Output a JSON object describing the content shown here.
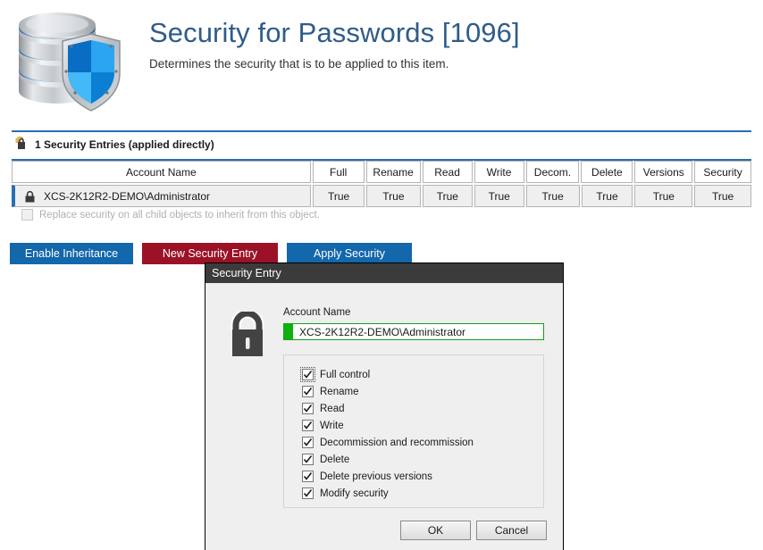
{
  "header": {
    "title": "Security for Passwords [1096]",
    "subtitle": "Determines the security that is to be applied to this item.",
    "icon": "database-shield-icon"
  },
  "section": {
    "icon": "open-lock-icon",
    "label": "1 Security Entries (applied directly)"
  },
  "grid": {
    "columns": [
      "Account Name",
      "Full",
      "Rename",
      "Read",
      "Write",
      "Decom.",
      "Delete",
      "Versions",
      "Security"
    ],
    "rows": [
      {
        "icon": "lock-icon",
        "account": "XCS-2K12R2-DEMO\\Administrator",
        "full": "True",
        "rename": "True",
        "read": "True",
        "write": "True",
        "decom": "True",
        "delete": "True",
        "versions": "True",
        "security": "True"
      }
    ]
  },
  "replace_option": {
    "label": "Replace security on all child objects to inherit from this object.",
    "checked": false,
    "enabled": false
  },
  "actions": {
    "enable_inheritance": "Enable Inheritance",
    "new_security_entry": "New Security Entry",
    "apply_security": "Apply Security"
  },
  "dialog": {
    "title": "Security Entry",
    "icon": "padlock-icon",
    "account_name_label": "Account Name",
    "account_name_value": "XCS-2K12R2-DEMO\\Administrator",
    "permissions": [
      {
        "label": "Full control",
        "checked": true,
        "focused": true
      },
      {
        "label": "Rename",
        "checked": true,
        "focused": false
      },
      {
        "label": "Read",
        "checked": true,
        "focused": false
      },
      {
        "label": "Write",
        "checked": true,
        "focused": false
      },
      {
        "label": "Decommission and recommission",
        "checked": true,
        "focused": false
      },
      {
        "label": "Delete",
        "checked": true,
        "focused": false
      },
      {
        "label": "Delete previous versions",
        "checked": true,
        "focused": false
      },
      {
        "label": "Modify security",
        "checked": true,
        "focused": false
      }
    ],
    "ok_label": "OK",
    "cancel_label": "Cancel"
  },
  "colors": {
    "accent_blue": "#2a6fb4",
    "button_blue": "#1367ab",
    "button_red": "#9b1226",
    "title_blue": "#2e5c8a",
    "field_green": "#0fb10f",
    "dialog_titlebar": "#3b3b3b"
  }
}
